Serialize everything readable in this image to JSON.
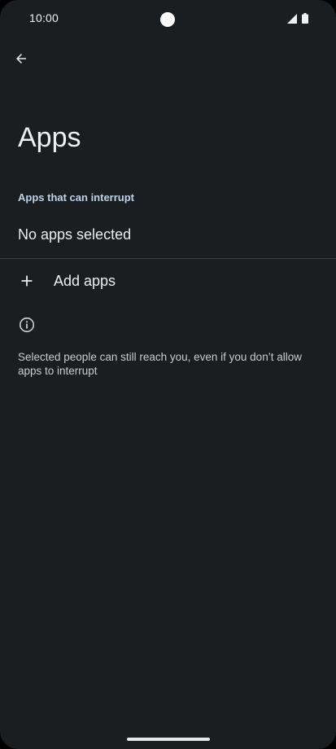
{
  "status_bar": {
    "time": "10:00",
    "icons": [
      "signal-icon",
      "battery-icon"
    ]
  },
  "toolbar": {
    "back_icon": "arrow-left-icon"
  },
  "page": {
    "title": "Apps"
  },
  "section": {
    "header": "Apps that can interrupt",
    "empty_state": "No apps selected"
  },
  "add_apps": {
    "icon": "plus-icon",
    "label": "Add apps"
  },
  "info": {
    "icon": "info-icon",
    "text": "Selected people can still reach you, even if you don’t allow apps to interrupt"
  },
  "colors": {
    "background": "#1b1e21",
    "accent_header": "#bcd3ea",
    "divider": "#3a3e42"
  }
}
